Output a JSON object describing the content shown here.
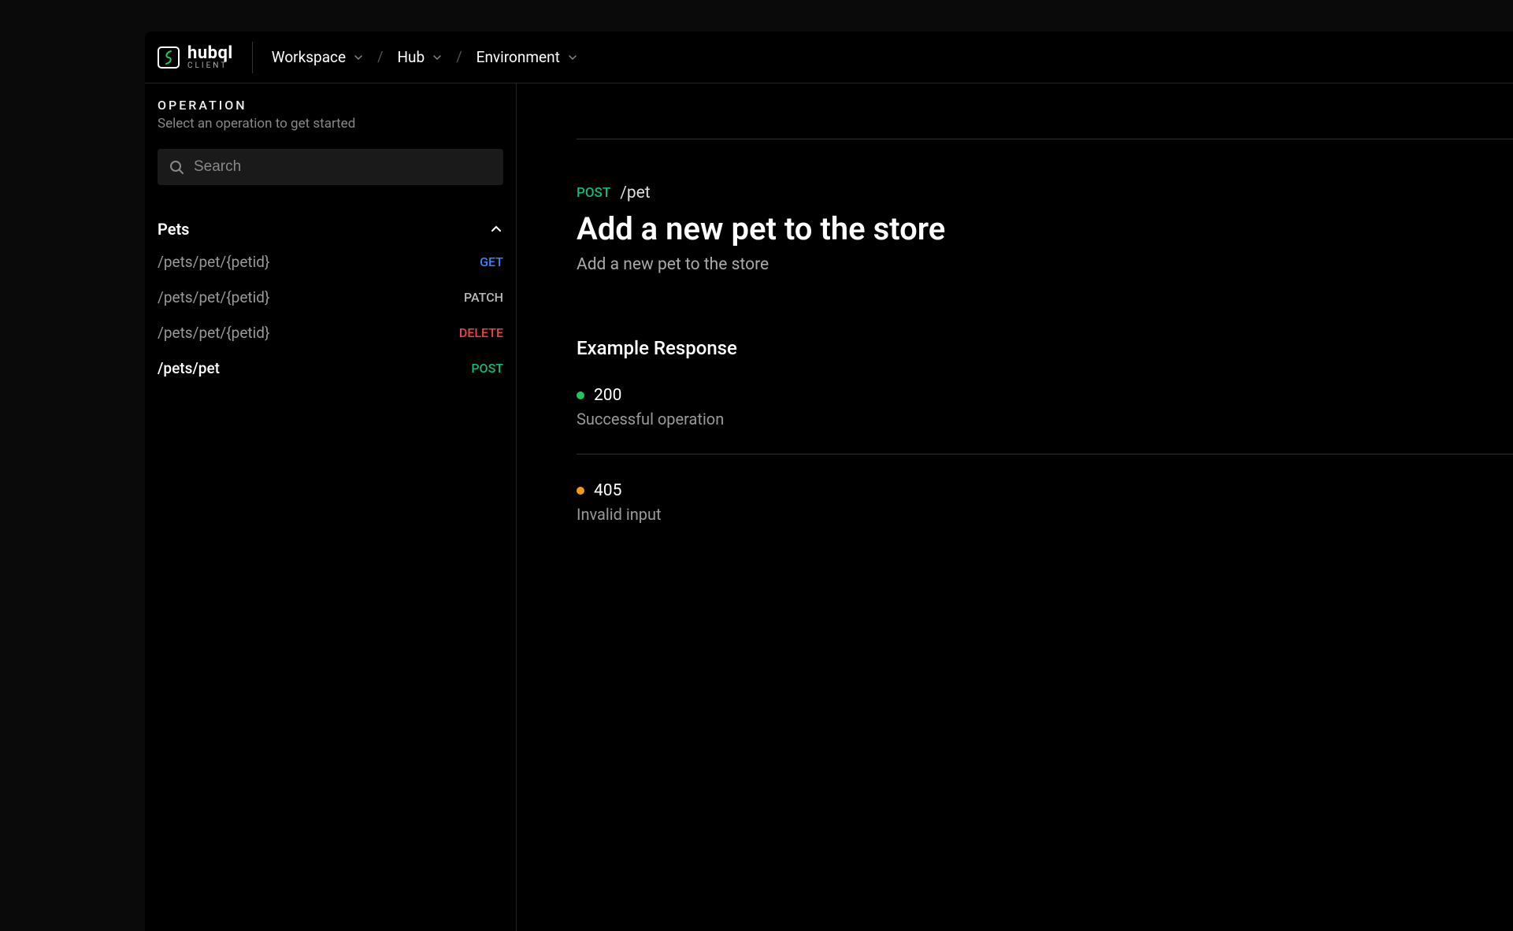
{
  "logo": {
    "title": "hubql",
    "subtitle": "CLIENT"
  },
  "breadcrumbs": [
    {
      "label": "Workspace"
    },
    {
      "label": "Hub"
    },
    {
      "label": "Environment"
    }
  ],
  "sidebar": {
    "section_label": "OPERATION",
    "section_desc": "Select an operation to get started",
    "search_placeholder": "Search",
    "group_title": "Pets",
    "operations": [
      {
        "path": "/pets/pet/{petid}",
        "method": "GET",
        "method_class": "method-get",
        "active": false
      },
      {
        "path": "/pets/pet/{petid}",
        "method": "PATCH",
        "method_class": "method-patch",
        "active": false
      },
      {
        "path": "/pets/pet/{petid}",
        "method": "DELETE",
        "method_class": "method-delete",
        "active": false
      },
      {
        "path": "/pets/pet",
        "method": "POST",
        "method_class": "method-post",
        "active": true
      }
    ]
  },
  "main": {
    "method": "POST",
    "path": "/pet",
    "title": "Add a new pet to the store",
    "description": "Add a new pet to the store",
    "response_section_title": "Example Response",
    "responses": [
      {
        "code": "200",
        "desc": "Successful operation",
        "dot_class": "dot-green"
      },
      {
        "code": "405",
        "desc": "Invalid input",
        "dot_class": "dot-orange"
      }
    ]
  }
}
